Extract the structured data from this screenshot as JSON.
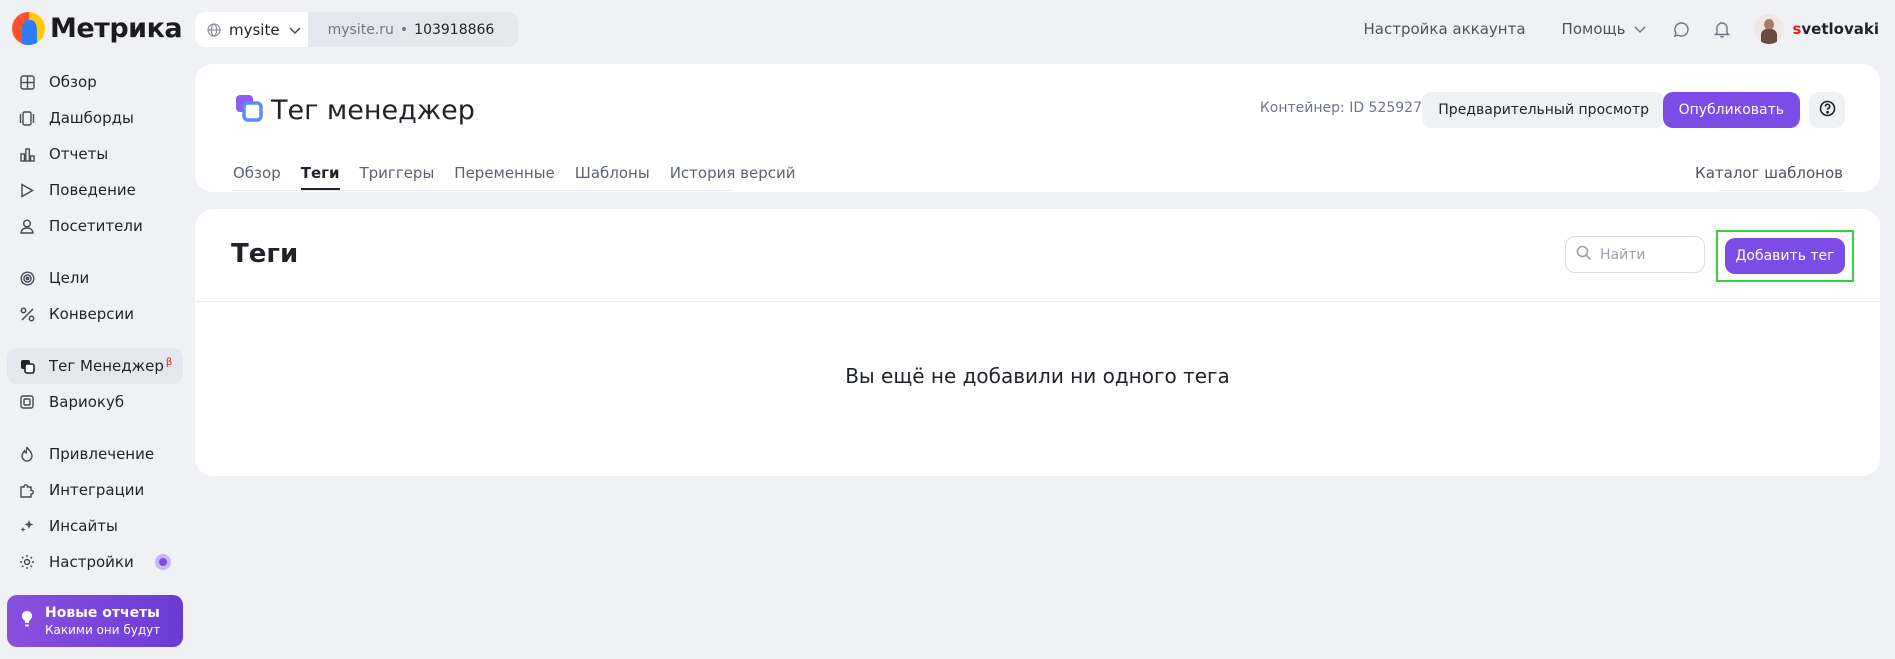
{
  "app": {
    "title": "Метрика"
  },
  "site": {
    "name": "mysite",
    "domain": "mysite.ru",
    "counter_id": "103918866"
  },
  "topbar": {
    "account_settings": "Настройка аккаунта",
    "help": "Помощь",
    "username_first": "s",
    "username_rest": "vetlovaki"
  },
  "sidebar": {
    "items": [
      {
        "label": "Обзор",
        "icon": "grid-icon"
      },
      {
        "label": "Дашборды",
        "icon": "dashboards-icon"
      },
      {
        "label": "Отчеты",
        "icon": "bar-chart-icon"
      },
      {
        "label": "Поведение",
        "icon": "play-icon"
      },
      {
        "label": "Посетители",
        "icon": "user-icon"
      },
      {
        "label": "Цели",
        "icon": "target-icon"
      },
      {
        "label": "Конверсии",
        "icon": "percent-icon"
      },
      {
        "label": "Тег Менеджер",
        "badge": "β",
        "icon": "tag-manager-icon"
      },
      {
        "label": "Вариокуб",
        "icon": "variocube-icon"
      },
      {
        "label": "Привлечение",
        "icon": "flame-icon"
      },
      {
        "label": "Интеграции",
        "icon": "puzzle-icon"
      },
      {
        "label": "Инсайты",
        "icon": "sparkle-icon"
      },
      {
        "label": "Настройки",
        "icon": "gear-icon"
      }
    ],
    "promo": {
      "title": "Новые отчеты",
      "subtitle": "Какими они будут"
    }
  },
  "header": {
    "title": "Тег менеджер",
    "container": "Контейнер: ID 525927",
    "preview_label": "Предварительный просмотр",
    "publish_label": "Опубликовать",
    "tabs": [
      "Обзор",
      "Теги",
      "Триггеры",
      "Переменные",
      "Шаблоны",
      "История версий"
    ],
    "active_tab": "Теги",
    "catalog_label": "Каталог шаблонов"
  },
  "main": {
    "title": "Теги",
    "search_placeholder": "Найти",
    "add_label": "Добавить тег",
    "empty_message": "Вы ещё не добавили ни одного тега"
  },
  "colors": {
    "accent": "#7d4ce6",
    "highlight": "#36d136",
    "background": "#eff1f5"
  }
}
